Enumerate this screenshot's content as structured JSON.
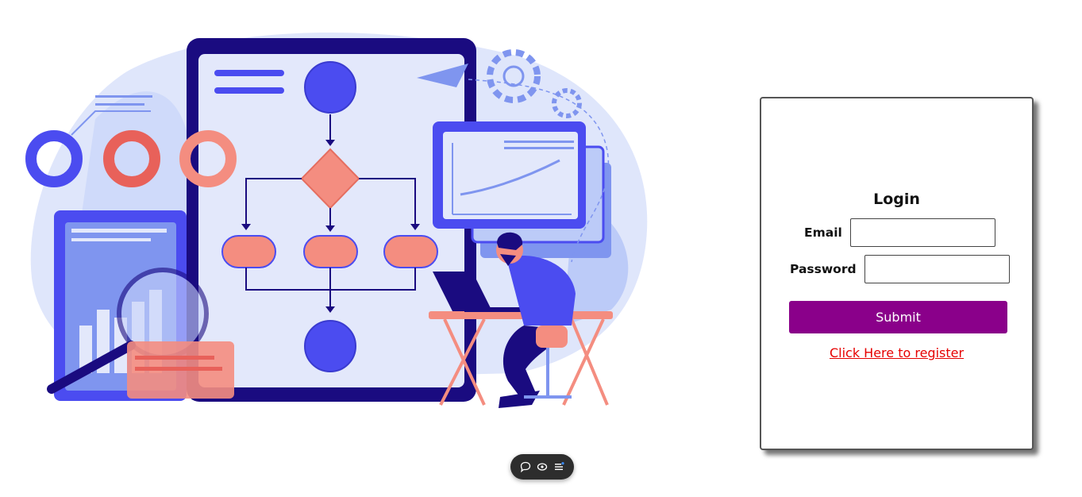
{
  "login": {
    "title": "Login",
    "email_label": "Email",
    "email_value": "",
    "password_label": "Password",
    "password_value": "",
    "submit_label": "Submit",
    "register_link": "Click Here to register"
  },
  "colors": {
    "submit_bg": "#8a008a",
    "link": "#e60000",
    "illustration_navy": "#1a0b80",
    "illustration_blue": "#4b4cf0",
    "illustration_coral": "#f48d80"
  },
  "toolbar": {
    "icons": [
      "comment-icon",
      "eye-icon",
      "menu-icon"
    ]
  }
}
